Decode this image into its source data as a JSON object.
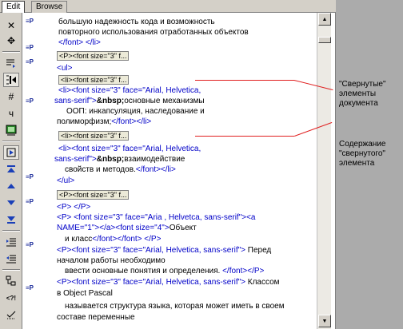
{
  "tabs": {
    "edit": "Edit",
    "browse": "Browse"
  },
  "toolbar": {
    "icons": [
      "close-icon",
      "move-icon",
      "wrap-icon",
      "collapse-icon",
      "hash-icon",
      "char-icon",
      "image-icon",
      "play-icon",
      "top-icon",
      "up-icon",
      "down-icon",
      "bottom-icon",
      "indent-icon",
      "outdent-icon",
      "format-icon",
      "expand-icon",
      "select-icon"
    ],
    "glyphs": {
      "close": "✕",
      "move": "✥",
      "hash": "#",
      "char": "ч"
    }
  },
  "gutter": {
    "marker": "≡P"
  },
  "code": {
    "l1": "большую надежность кода и возможность",
    "l2": "повторного использования отработанных объектов",
    "l3": "</font> </li>",
    "l4_box": "<P><font size=\"3\" f...",
    "l5": "<ul>",
    "l6_box": "<li><font size=\"3\" f...",
    "l7_tag": "<li><font size=\"3\" face=\"Arial, Helvetica,",
    "l8_tag": "sans-serif\">",
    "l8_kw": "&nbsp;",
    "l8_txt": "основные механизмы",
    "l9": "ООП: инкапсуляция, наследование и",
    "l10_txt": "полиморфизм;",
    "l10_tag": "</font></li>",
    "l11_box": "<li><font size=\"3\" f...",
    "l12_tag": "<li><font size=\"3\" face=\"Arial, Helvetica,",
    "l13_tag": "sans-serif\">",
    "l13_kw": "&nbsp;",
    "l13_txt": "взаимодействие",
    "l14_txt": "свойств и методов.",
    "l14_tag": "</font></li>",
    "l15": "</ul>",
    "l16_box": "<P><font size=\"3\" f...",
    "l17": "<P> </P>",
    "l18_tag": "<P> <font size=\"3\" face=\"Aria , Helvetca, sans-serif\"><a",
    "l19_tag": "NAME=\"1\"></a><font size=\"4\">",
    "l19_txt": "Объект",
    "l20_txt": "и класс",
    "l20_tag": "</font></font> </P>",
    "l21_tag": "<P><font size=\"3\" face=\"Arial, Helvetica, sans-serif\">",
    "l21_txt": " Перед",
    "l22": "началом работы необходимо",
    "l23_txt": "ввести основные понятия и определения.",
    "l23_tag": " </font></P>",
    "l24_tag": "<P><font size=\"3\" face=\"Arial, Helvetica, sans-serif\">",
    "l24_txt": " Классом",
    "l25": "в Object Pascal",
    "l26": "называется структура языка, которая может иметь в своем",
    "l27": "составе переменные"
  },
  "callouts": {
    "collapsed": "\"Свернутые\" элементы документа",
    "content": "Содержание \"свернутого\" элемента"
  },
  "colors": {
    "tag": "#0000c8",
    "callout_line": "#e02020",
    "background": "#ababab"
  }
}
